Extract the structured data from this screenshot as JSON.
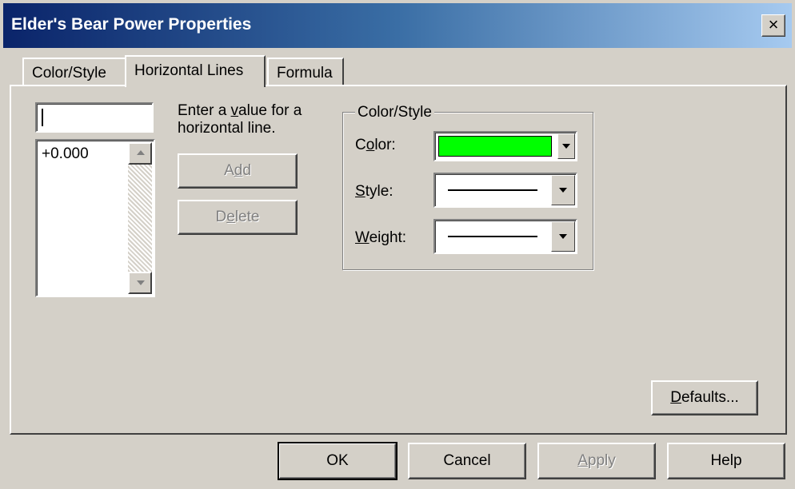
{
  "window": {
    "title": "Elder's Bear Power Properties",
    "close_glyph": "×"
  },
  "tabs": [
    {
      "label": "Color/Style",
      "active": false
    },
    {
      "label": "Horizontal Lines",
      "active": true
    },
    {
      "label": "Formula",
      "active": false
    }
  ],
  "hlines": {
    "value_input": "",
    "list_items": [
      "+0.000"
    ],
    "hint": "Enter a value for a horizontal line.",
    "hint_line1_pre": "Enter a ",
    "hint_line1_u": "v",
    "hint_line1_post": "alue for a",
    "hint_line2": "horizontal line.",
    "add_button": {
      "pre": "A",
      "u": "d",
      "post": "d"
    },
    "delete_button": {
      "pre": "D",
      "u": "e",
      "post": "lete"
    }
  },
  "color_style": {
    "legend": "Color/Style",
    "color_label": {
      "pre": "C",
      "u": "o",
      "post": "lor:"
    },
    "color_value": "#00ff00",
    "style_label": {
      "u": "S",
      "post": "tyle:"
    },
    "weight_label": {
      "u": "W",
      "post": "eight:"
    }
  },
  "defaults_button": {
    "u": "D",
    "post": "efaults..."
  },
  "footer": {
    "ok": "OK",
    "cancel": "Cancel",
    "apply": {
      "u": "A",
      "post": "pply"
    },
    "help": "Help"
  }
}
